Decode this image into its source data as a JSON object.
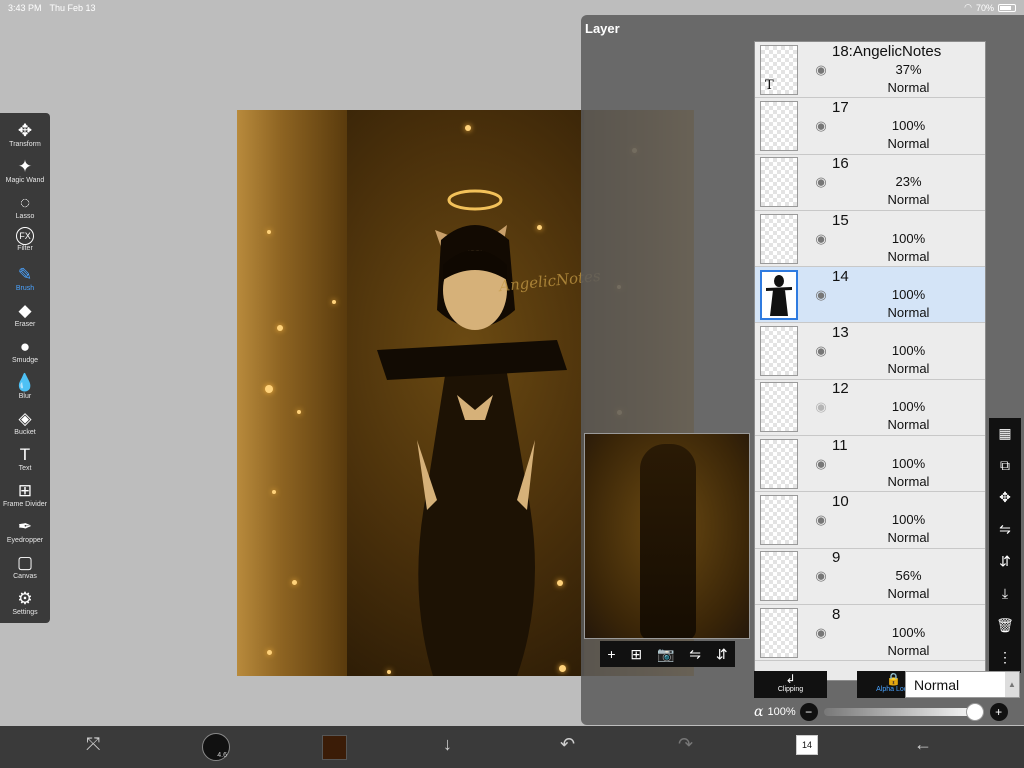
{
  "status_bar": {
    "time": "3:43 PM",
    "date": "Thu Feb 13",
    "battery": "70%",
    "battery_level": 0.7
  },
  "toolbar": {
    "tools": [
      {
        "label": "Transform",
        "icon": "move-icon",
        "glyph": "✥"
      },
      {
        "label": "Magic Wand",
        "icon": "magic-wand-icon",
        "glyph": "✦"
      },
      {
        "label": "Lasso",
        "icon": "lasso-icon",
        "glyph": "◌"
      },
      {
        "label": "Filter",
        "icon": "fx-icon",
        "glyph": "FX"
      },
      {
        "label": "Brush",
        "icon": "brush-icon",
        "glyph": "✎",
        "active": true
      },
      {
        "label": "Eraser",
        "icon": "eraser-icon",
        "glyph": "◆"
      },
      {
        "label": "Smudge",
        "icon": "smudge-icon",
        "glyph": "●"
      },
      {
        "label": "Blur",
        "icon": "blur-drop-icon",
        "glyph": "💧"
      },
      {
        "label": "Bucket",
        "icon": "bucket-icon",
        "glyph": "◈"
      },
      {
        "label": "Text",
        "icon": "text-icon",
        "glyph": "T"
      },
      {
        "label": "Frame Divider",
        "icon": "frame-divider-icon",
        "glyph": "⊞"
      },
      {
        "label": "Eyedropper",
        "icon": "eyedropper-icon",
        "glyph": "✒"
      },
      {
        "label": "Canvas",
        "icon": "canvas-icon",
        "glyph": "▢"
      },
      {
        "label": "Settings",
        "icon": "gear-icon",
        "glyph": "⚙"
      }
    ]
  },
  "canvas": {
    "watermark": "AngelicNotes"
  },
  "layer_panel": {
    "title": "Layer",
    "layers": [
      {
        "name": "18:AngelicNotes",
        "opacity": "37%",
        "mode": "Normal",
        "visible": true,
        "text_layer": true
      },
      {
        "name": "17",
        "opacity": "100%",
        "mode": "Normal",
        "visible": true
      },
      {
        "name": "16",
        "opacity": "23%",
        "mode": "Normal",
        "visible": true
      },
      {
        "name": "15",
        "opacity": "100%",
        "mode": "Normal",
        "visible": true
      },
      {
        "name": "14",
        "opacity": "100%",
        "mode": "Normal",
        "visible": true,
        "selected": true
      },
      {
        "name": "13",
        "opacity": "100%",
        "mode": "Normal",
        "visible": true
      },
      {
        "name": "12",
        "opacity": "100%",
        "mode": "Normal",
        "visible": false
      },
      {
        "name": "11",
        "opacity": "100%",
        "mode": "Normal",
        "visible": true
      },
      {
        "name": "10",
        "opacity": "100%",
        "mode": "Normal",
        "visible": true
      },
      {
        "name": "9",
        "opacity": "56%",
        "mode": "Normal",
        "visible": true
      },
      {
        "name": "8",
        "opacity": "100%",
        "mode": "Normal",
        "visible": true
      }
    ],
    "clipping_label": "Clipping",
    "alpha_lock_label": "Alpha Lock",
    "blend_mode": "Normal",
    "opacity_label": "100%",
    "opacity_value": 1.0
  },
  "bottom_bar": {
    "brush_size": "4.6",
    "layer_count": "14",
    "color": "#3b1c07"
  },
  "colors": {
    "accent": "#4aa3ff",
    "selected_row": "#d4e4f7"
  }
}
